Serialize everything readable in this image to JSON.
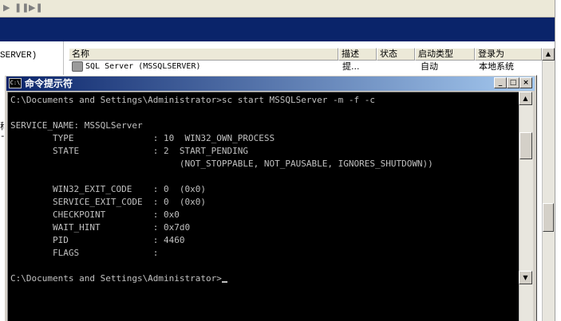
{
  "background_window": {
    "toolbar_icons": [
      "play-icon",
      "pause-icon",
      "play-pause-icon"
    ],
    "left_panel_label": "SERVER)",
    "columns": [
      {
        "label": "名称"
      },
      {
        "label": "描述"
      },
      {
        "label": "状态"
      },
      {
        "label": "启动类型"
      },
      {
        "label": "登录为"
      }
    ],
    "service_row": {
      "name": "SQL Server (MSSQLSERVER)",
      "description": "提...",
      "status": "",
      "startup_type": "自动",
      "log_on_as": "本地系统"
    },
    "left_fragments": [
      "称",
      "-"
    ]
  },
  "console_window": {
    "title": "命令提示符",
    "title_icon_text": "C:\\",
    "buttons": {
      "minimize": "_",
      "maximize": "□",
      "close": "×"
    },
    "lines": [
      "C:\\Documents and Settings\\Administrator>sc start MSSQLServer -m -f -c",
      "",
      "SERVICE_NAME: MSSQLServer",
      "        TYPE               : 10  WIN32_OWN_PROCESS",
      "        STATE              : 2  START_PENDING",
      "                                (NOT_STOPPABLE, NOT_PAUSABLE, IGNORES_SHUTDOWN))",
      "",
      "        WIN32_EXIT_CODE    : 0  (0x0)",
      "        SERVICE_EXIT_CODE  : 0  (0x0)",
      "        CHECKPOINT         : 0x0",
      "        WAIT_HINT          : 0x7d0",
      "        PID                : 4460",
      "        FLAGS              :",
      "",
      "C:\\Documents and Settings\\Administrator>"
    ],
    "scroll_up_glyph": "▲",
    "scroll_down_glyph": "▼"
  },
  "colors": {
    "console_bg": "#000000",
    "console_text": "#c0c0c0",
    "titlebar_start": "#0a246a",
    "titlebar_end": "#a6caf0"
  }
}
